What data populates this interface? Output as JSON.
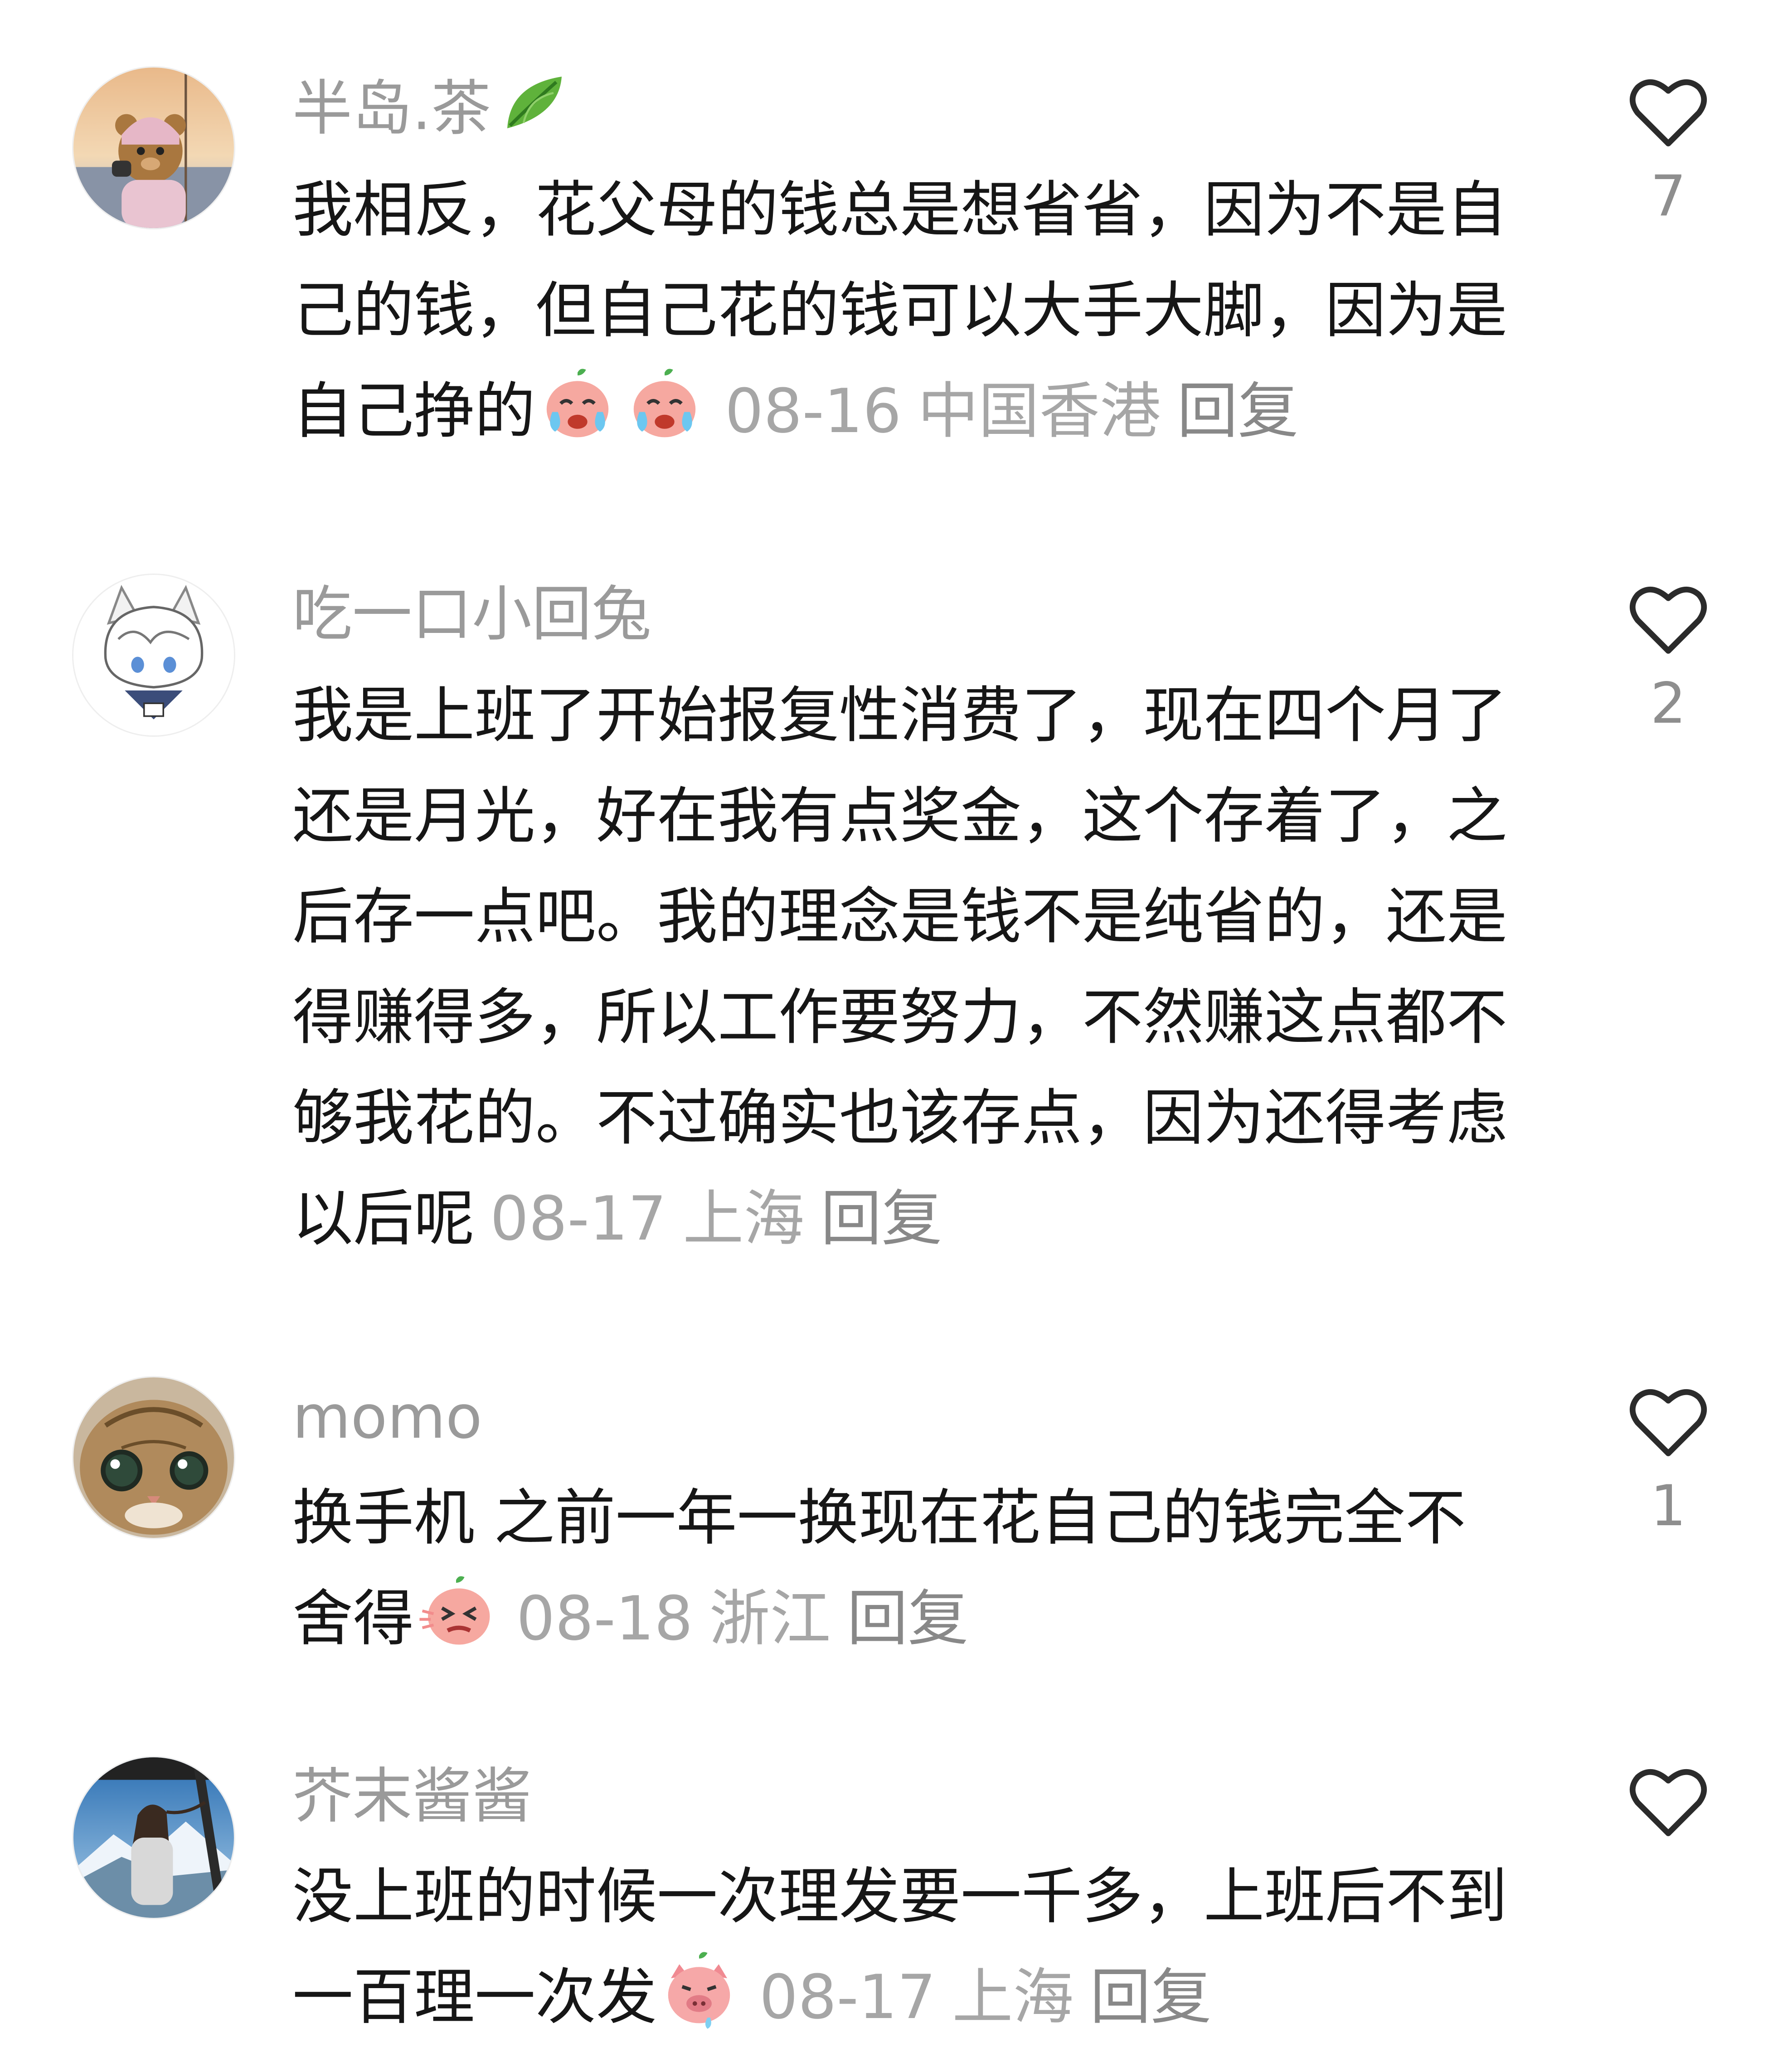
{
  "comments": [
    {
      "username": "半岛.茶",
      "username_tag": "leaf-emoji",
      "text_before_emoji": "我相反，花父母的钱总是想省省，因为不是自己的钱，但自己花的钱可以大手大脚，因为是自己挣的",
      "emojis": [
        "crying-peach-emoji",
        "crying-peach-emoji"
      ],
      "date": "08-16",
      "region": "中国香港",
      "reply_label": "回复",
      "like_count": "7",
      "avatar_icon": "teddy-bear-avatar"
    },
    {
      "username": "吃一口小回兔",
      "text_before_emoji": "我是上班了开始报复性消费了，现在四个月了还是月光，好在我有点奖金，这个存着了，之后存一点吧。我的理念是钱不是纯省的，还是得赚得多，所以工作要努力，不然赚这点都不够我花的。不过确实也该存点，因为还得考虑以后呢",
      "emojis": [],
      "date": "08-17",
      "region": "上海",
      "reply_label": "回复",
      "like_count": "2",
      "avatar_icon": "anime-boy-avatar"
    },
    {
      "username": "momo",
      "text_before_emoji": "换手机 之前一年一换现在花自己的钱完全不舍得",
      "emojis": [
        "wincing-peach-emoji"
      ],
      "date": "08-18",
      "region": "浙江",
      "reply_label": "回复",
      "like_count": "1",
      "avatar_icon": "cat-avatar"
    },
    {
      "username": "芥末酱酱",
      "text_before_emoji": "没上班的时候一次理发要一千多，上班后不到一百理一次发",
      "emojis": [
        "pig-emoji"
      ],
      "date": "08-17",
      "region": "上海",
      "reply_label": "回复",
      "like_count": "",
      "avatar_icon": "mountain-girl-avatar"
    }
  ],
  "colors": {
    "username": "#9a9a9a",
    "text": "#161616",
    "meta": "#a6a6a6",
    "heart_stroke": "#2b2b2b"
  }
}
